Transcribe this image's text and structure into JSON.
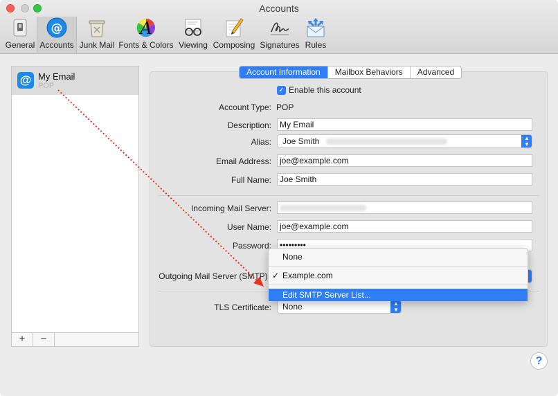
{
  "window": {
    "title": "Accounts"
  },
  "toolbar": {
    "items": [
      {
        "label": "General",
        "icon": "switch-icon"
      },
      {
        "label": "Accounts",
        "icon": "at-sign-icon",
        "selected": true
      },
      {
        "label": "Junk Mail",
        "icon": "trash-bin-icon"
      },
      {
        "label": "Fonts & Colors",
        "icon": "font-palette-icon"
      },
      {
        "label": "Viewing",
        "icon": "eyeglasses-icon"
      },
      {
        "label": "Composing",
        "icon": "pencil-paper-icon"
      },
      {
        "label": "Signatures",
        "icon": "signature-icon"
      },
      {
        "label": "Rules",
        "icon": "envelope-arrows-icon"
      }
    ]
  },
  "accounts": {
    "items": [
      {
        "name": "My Email",
        "type": "POP"
      }
    ],
    "add_label": "+",
    "remove_label": "−"
  },
  "tabs": [
    {
      "label": "Account Information",
      "active": true
    },
    {
      "label": "Mailbox Behaviors"
    },
    {
      "label": "Advanced"
    }
  ],
  "form": {
    "enable_label": "Enable this account",
    "enabled": true,
    "account_type_label": "Account Type:",
    "account_type_value": "POP",
    "description_label": "Description:",
    "description_value": "My Email",
    "alias_label": "Alias:",
    "alias_value": "Joe Smith",
    "email_label": "Email Address:",
    "email_value": "joe@example.com",
    "fullname_label": "Full Name:",
    "fullname_value": "Joe Smith",
    "incoming_label": "Incoming Mail Server:",
    "username_label": "User Name:",
    "username_value": "joe@example.com",
    "password_label": "Password:",
    "password_value": "•••••••••",
    "outgoing_label": "Outgoing Mail Server (SMTP):",
    "tls_label": "TLS Certificate:",
    "tls_value": "None"
  },
  "smtp_menu": {
    "items": [
      {
        "label": "None"
      },
      {
        "label": "Example.com",
        "checked": true
      },
      {
        "label": "Edit SMTP Server List...",
        "highlighted": true
      }
    ],
    "check_mark": "✓"
  },
  "help": {
    "label": "?"
  },
  "colors": {
    "accent": "#2f7ef6",
    "annotation_arrow": "#e8321e"
  }
}
